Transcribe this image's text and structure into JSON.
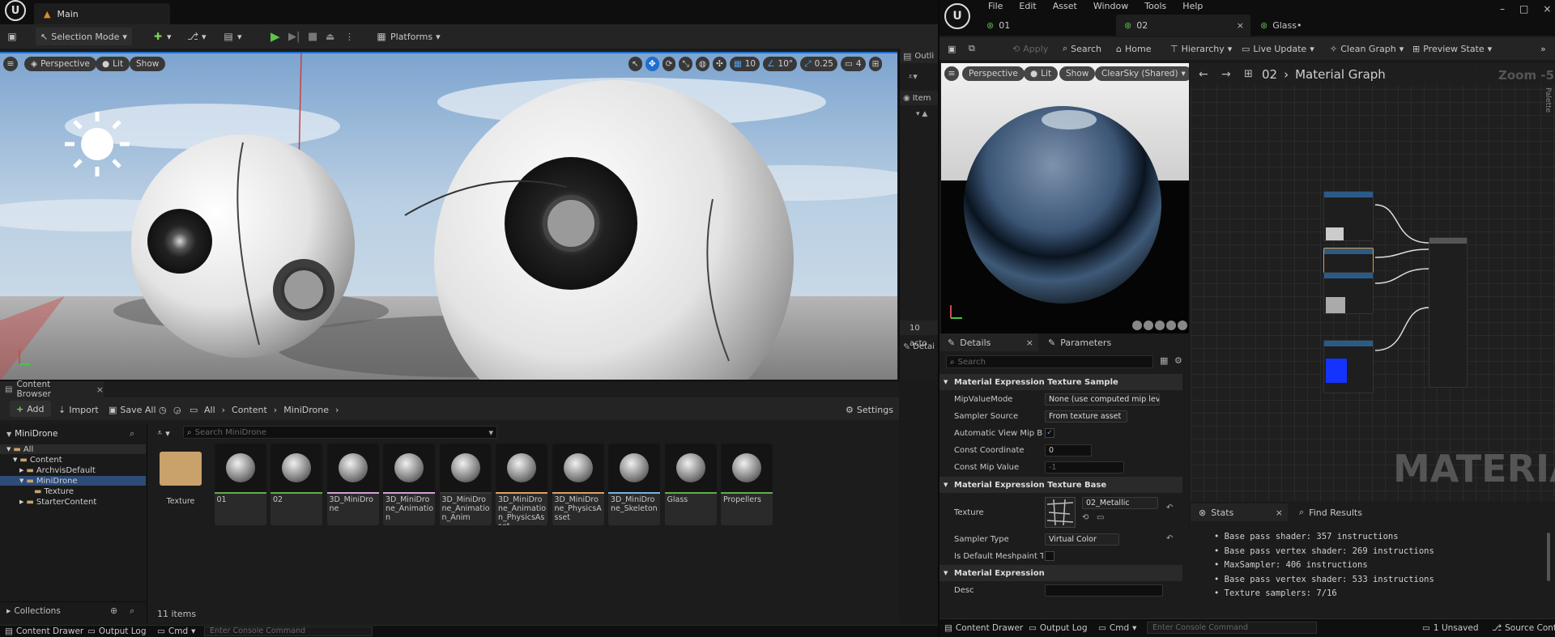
{
  "left": {
    "tab_title": "Main",
    "toolbar": {
      "selection_mode": "Selection Mode",
      "platforms": "Platforms"
    },
    "viewport": {
      "perspective": "Perspective",
      "lit": "Lit",
      "show": "Show",
      "grid_snap": "10",
      "rotate_snap": "10°",
      "scale_snap": "0.25",
      "camera_speed": "4"
    },
    "outliner": {
      "title": "Outli",
      "item_col": "Item",
      "actor_count": "10 acto",
      "details": "Detai"
    },
    "content_browser": {
      "title": "Content Browser",
      "add": "Add",
      "import": "Import",
      "save_all": "Save All",
      "breadcrumb": [
        "All",
        "Content",
        "MiniDrone"
      ],
      "settings": "Settings",
      "tree_title": "MiniDrone",
      "tree": [
        "All",
        "Content",
        "ArchvisDefault",
        "MiniDrone",
        "Texture",
        "StarterContent"
      ],
      "search_placeholder": "Search MiniDrone",
      "items_count": "11 items",
      "collections": "Collections",
      "assets": [
        {
          "name": "Texture",
          "kind": "folder"
        },
        {
          "name": "01",
          "bar": "#5bb04a"
        },
        {
          "name": "02",
          "bar": "#5bb04a"
        },
        {
          "name": "3D_MiniDrone",
          "bar": "#d4a0d8"
        },
        {
          "name": "3D_MiniDrone_Animation",
          "bar": "#d4a0d8"
        },
        {
          "name": "3D_MiniDrone_Animation_Anim",
          "bar": "#3a3a3a"
        },
        {
          "name": "3D_MiniDrone_Animation_PhysicsAsset",
          "bar": "#e0a060"
        },
        {
          "name": "3D_MiniDrone_PhysicsAsset",
          "bar": "#e0a060"
        },
        {
          "name": "3D_MiniDrone_Skeleton",
          "bar": "#7ab0e0"
        },
        {
          "name": "Glass",
          "bar": "#5bb04a"
        },
        {
          "name": "Propellers",
          "bar": "#5bb04a"
        }
      ]
    },
    "bottom": {
      "content_drawer": "Content Drawer",
      "output_log": "Output Log",
      "cmd": "Cmd",
      "console_placeholder": "Enter Console Command"
    }
  },
  "right": {
    "menu": [
      "File",
      "Edit",
      "Asset",
      "Window",
      "Tools",
      "Help"
    ],
    "tabs": [
      "01",
      "02",
      "Glass•"
    ],
    "toolbar": [
      "Apply",
      "Search",
      "Home",
      "Hierarchy",
      "Live Update",
      "Clean Graph",
      "Preview State"
    ],
    "preview": {
      "perspective": "Perspective",
      "lit": "Lit",
      "show": "Show",
      "sky": "ClearSky (Shared)"
    },
    "graph": {
      "breadcrumb_root": "02",
      "breadcrumb_current": "Material Graph",
      "zoom": "Zoom -5",
      "watermark": "MATERIAL",
      "palette": "Palette"
    },
    "details": {
      "tab_details": "Details",
      "tab_parameters": "Parameters",
      "search_placeholder": "Search",
      "section1": "Material Expression Texture Sample",
      "mip_value_mode_label": "MipValueMode",
      "mip_value_mode": "None (use computed mip leve",
      "sampler_source_label": "Sampler Source",
      "sampler_source": "From texture asset",
      "auto_view_mip_label": "Automatic View Mip Bias",
      "const_coord_label": "Const Coordinate",
      "const_coord": "0",
      "const_mip_label": "Const Mip Value",
      "const_mip": "-1",
      "section2": "Material Expression Texture Base",
      "texture_label": "Texture",
      "texture": "02_Metallic",
      "sampler_type_label": "Sampler Type",
      "sampler_type": "Virtual Color",
      "default_meshpaint_label": "Is Default Meshpaint T...",
      "section3": "Material Expression",
      "desc_label": "Desc"
    },
    "stats": {
      "tab_stats": "Stats",
      "tab_find": "Find Results",
      "lines": [
        "Base pass shader: 357 instructions",
        "Base pass vertex shader: 269 instructions",
        "MaxSampler: 406 instructions",
        "Base pass vertex shader: 533 instructions",
        "Texture samplers: 7/16"
      ]
    },
    "bottom": {
      "content_drawer": "Content Drawer",
      "output_log": "Output Log",
      "cmd": "Cmd",
      "console_placeholder": "Enter Console Command",
      "unsaved": "1 Unsaved",
      "source_control": "Source Contr"
    }
  }
}
